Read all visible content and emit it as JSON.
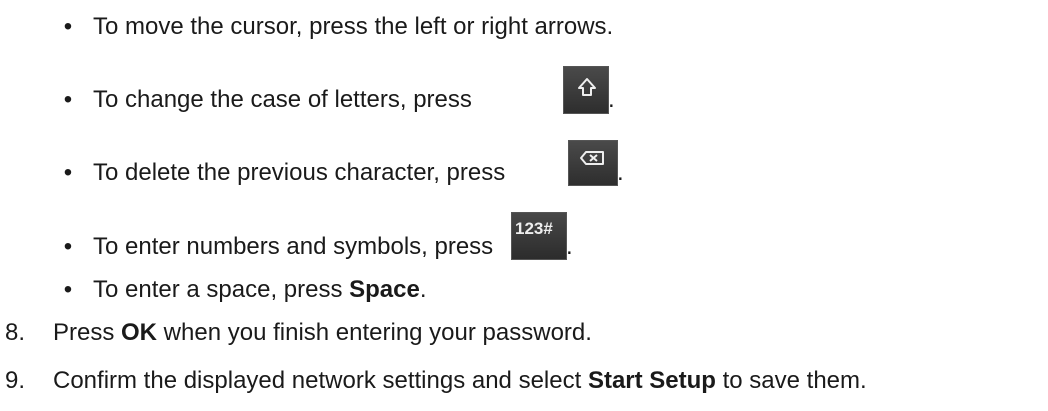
{
  "bullets": [
    {
      "marker": "•",
      "text": "To move the cursor, press the left or right arrows."
    },
    {
      "marker": "•",
      "text": "To change the case of letters, press ",
      "after": ".",
      "key_icon": "shift-key-icon"
    },
    {
      "marker": "•",
      "text": "To delete the previous character, press ",
      "after": ".",
      "key_icon": "backspace-key-icon"
    },
    {
      "marker": "•",
      "text": "To enter numbers and symbols, press ",
      "after": ".",
      "key_icon": "numbers-symbols-key-icon",
      "key_label": "123#"
    },
    {
      "marker": "•",
      "text_before": "To enter a space, press ",
      "bold": "Space",
      "after": "."
    }
  ],
  "steps": [
    {
      "number": "8.",
      "before": "Press ",
      "bold": "OK",
      "after": " when you finish entering your password."
    },
    {
      "number": "9.",
      "before": "Confirm the displayed network settings and select ",
      "bold": "Start Setup",
      "after": " to save them."
    }
  ],
  "colors": {
    "text": "#1a1a1a",
    "key_background": "#3a3a3a",
    "key_glyph": "#eeeeee"
  }
}
